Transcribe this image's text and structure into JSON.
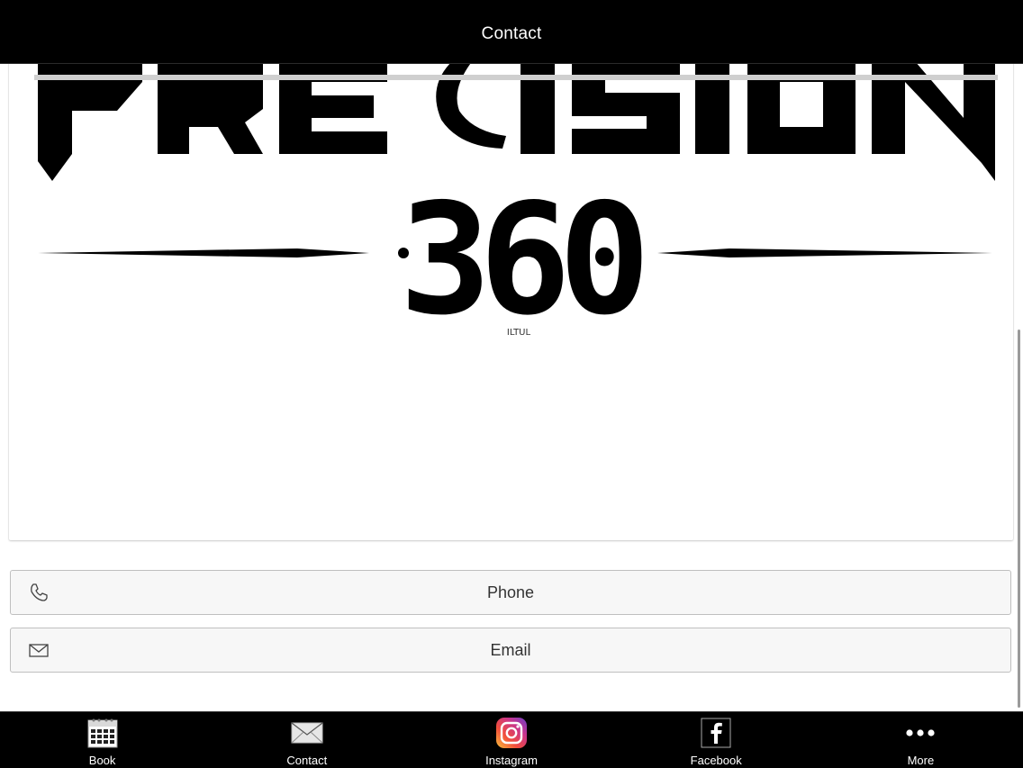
{
  "header": {
    "title": "Contact"
  },
  "logo": {
    "text_top": "PRECISION",
    "text_number": "360",
    "text_small": "ILTUL"
  },
  "actions": {
    "phone_label": "Phone",
    "email_label": "Email"
  },
  "tabbar": {
    "items": [
      {
        "label": "Book",
        "icon": "calendar-icon"
      },
      {
        "label": "Contact",
        "icon": "envelope-icon"
      },
      {
        "label": "Instagram",
        "icon": "instagram-icon"
      },
      {
        "label": "Facebook",
        "icon": "facebook-icon"
      },
      {
        "label": "More",
        "icon": "more-dots-icon"
      }
    ]
  },
  "colors": {
    "bar_background": "#000000",
    "button_background": "#f7f7f7",
    "button_border": "#bfbfbf"
  }
}
